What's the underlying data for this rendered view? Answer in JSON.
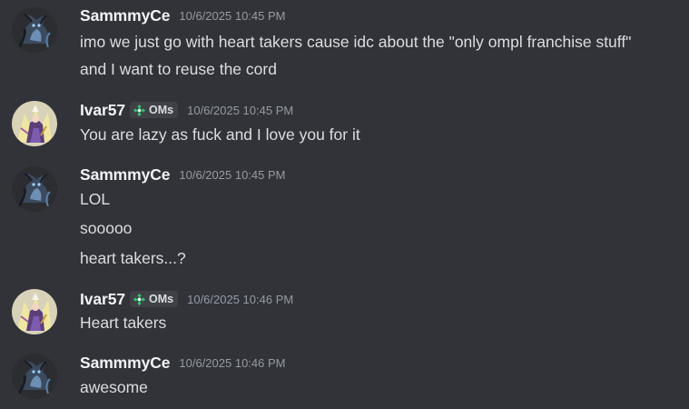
{
  "colors": {
    "background": "#323339",
    "username": "#f2f3f5",
    "message_text": "#dbdee1",
    "timestamp": "#949ba4",
    "tag_background": "#3f4147",
    "tag_icon": "#2ecc71"
  },
  "messages": [
    {
      "author": "SammmyCe",
      "avatar": "dragon-avatar",
      "tag": null,
      "timestamp": "10/6/2025 10:45 PM",
      "lines": [
        "imo we just go with heart takers cause idc about the \"only ompl franchise stuff\"",
        "and I want to reuse the cord"
      ]
    },
    {
      "author": "Ivar57",
      "avatar": "character-avatar",
      "tag": "OMs",
      "tag_icon": "diamond-arrows-icon",
      "timestamp": "10/6/2025 10:45 PM",
      "lines": [
        "You are lazy as fuck and I love you for it"
      ]
    },
    {
      "author": "SammmyCe",
      "avatar": "dragon-avatar",
      "tag": null,
      "timestamp": "10/6/2025 10:45 PM",
      "lines": [
        "LOL",
        "sooooo",
        "heart takers...?"
      ]
    },
    {
      "author": "Ivar57",
      "avatar": "character-avatar",
      "tag": "OMs",
      "tag_icon": "diamond-arrows-icon",
      "timestamp": "10/6/2025 10:46 PM",
      "lines": [
        "Heart takers"
      ]
    },
    {
      "author": "SammmyCe",
      "avatar": "dragon-avatar",
      "tag": null,
      "timestamp": "10/6/2025 10:46 PM",
      "lines": [
        "awesome"
      ]
    }
  ]
}
